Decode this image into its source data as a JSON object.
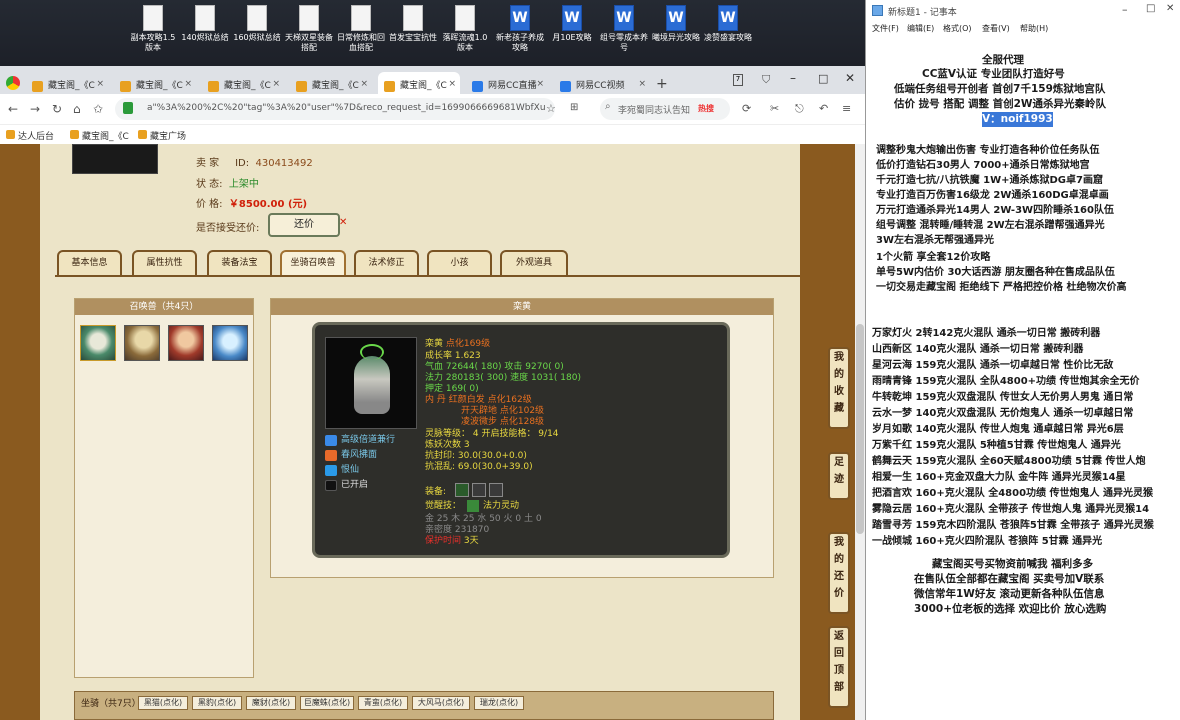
{
  "desktop": {
    "icons": [
      "副本攻略1.5版本",
      "140烬狱总结",
      "160烬狱总结",
      "天梯双星装备搭配",
      "日常修炼和回血搭配",
      "首发宝宝抗性",
      "落晖流魂1.0版本",
      "新老孩子养成攻略",
      "月10E攻略",
      "组号零成本养号",
      "曦境异光攻略",
      "凌赞盛宴攻略"
    ]
  },
  "browser": {
    "tabs": [
      "藏宝阁_《C",
      "藏宝阁_《C",
      "藏宝阁_《C",
      "藏宝阁_《C",
      "藏宝阁_《C",
      "网易CC直播",
      "网易CC视频"
    ],
    "url": "a\"%3A%200%2C%20\"tag\"%3A%20\"user\"%7D&reco_request_id=1699066669681WbfXu",
    "search": "李宛蜀同志认告知",
    "hot": "热搜",
    "bookmarks": [
      "达人后台",
      "藏宝阁_《C",
      "藏宝广场"
    ]
  },
  "listing": {
    "seller_label": "卖  家",
    "id_label": "ID:",
    "id_value": "430413492",
    "status_label": "状        态:",
    "status_value": "上架中",
    "price_label": "价        格:",
    "price_value": "￥8500.00 (元)",
    "offer_label": "是否接受还价:",
    "offer_button": "还价"
  },
  "tabs": [
    "基本信息",
    "属性抗性",
    "装备法宝",
    "坐骑召唤兽",
    "法术修正",
    "小孩",
    "外观道具"
  ],
  "pets_panel": {
    "title": "召唤兽（共4只）"
  },
  "detail_panel": {
    "title": "栾黄"
  },
  "card": {
    "name": "栾黄",
    "name_tag": "点化169级",
    "growth": "成长率 1.623",
    "hp": "气血 72644( 180) 攻击 9270( 0)",
    "mp": "法力 280183( 300) 速度 1031( 180)",
    "fate": "押定 169( 0)",
    "neidan1": "内    丹 红颜白发 点化162级",
    "neidan2": "开天辟地 点化102级",
    "neidan3": "凌波微步 点化128级",
    "skills": [
      "高级倍道兼行",
      "春风拂面",
      "恨仙",
      "已开启"
    ],
    "spirit": "灵脉等级： 4 开启技能格： 9/14",
    "refine": "炼妖次数 3",
    "resist1": "抗封印: 30.0(30.0+0.0)",
    "resist2": "抗混乱: 69.0(30.0+39.0)",
    "equip_label": "装备:",
    "awaken_label": "觉醒技：",
    "awaken_value": "法力灵动",
    "elements": "金 25  木 25  水 50  火 0  土 0",
    "intimacy": "亲密度 231870",
    "protect": "保护时间",
    "protect_value": "3天"
  },
  "side_buttons": [
    "我的收藏",
    "足迹",
    "我的还价",
    "返回顶部"
  ],
  "bottom": {
    "label": "坐骑（共7只）",
    "tabs": [
      "黑猫(点化)",
      "黑豹(点化)",
      "魔豺(点化)",
      "巨魔蛛(点化)",
      "青蛮(点化)",
      "大风马(点化)",
      "瑞龙(点化)"
    ]
  },
  "notepad": {
    "title": "新标题1 - 记事本",
    "menu": [
      "文件(F)",
      "编辑(E)",
      "格式(O)",
      "查看(V)",
      "帮助(H)"
    ],
    "lines": [
      "全服代理",
      "CC蓝V认证  专业团队打造好号",
      "低端任务组号开创者        首创7千159炼狱地宫队",
      "估价 拢号 搭配 调整        首创2W通杀异光秦岭队",
      "V：noif1993",
      "调整秒鬼大炮输出伤害          专业打造各种价位任务队伍",
      "低价打造钻石30男人               7000+通杀日常炼狱地宫",
      "千元打造七抗/八抗铁魔          1W+通杀炼狱DG卓7画窟",
      "专业打造百万伤害16级龙         2W通杀160DG卓混卓画",
      "万元打造通杀异光14男人        2W-3W四阶睡杀160队伍",
      "组号调整 混转睡/睡转混        2W左右混杀蹭帮强通异光",
      "                                                3W左右混杀无帮强通异光",
      "1个火箭 享全套12价攻略",
      "单号5W内估价 30大话西游       朋友圈各种在售成品队伍",
      "一切交易走藏宝阁 拒绝线下    严格把控价格 杜绝物次价高",
      "万家灯火 2转142克火混队 通杀一切日常 搬砖利器",
      "山西新区 140克火混队 通杀一切日常 搬砖利器",
      "星河云海 159克火混队 通杀一切卓越日常 性价比无敌",
      "雨晴青锋 159克火混队 全队4800+功绩 传世炮其余全无价",
      "牛转乾坤 159克火双盘混队 传世女人无价男人男鬼 通日常",
      "云水一梦 140克火双盘混队 无价炮鬼人 通杀一切卓越日常",
      "岁月如歌 140克火混队 传世人炮鬼 通卓越日常 异光6层",
      "万紫千红 159克火混队 5种植5甘霖 传世炮鬼人 通异光",
      "鹤舞云天 159克火混队 全60天赋4800功绩 5甘霖 传世人炮",
      "相爱一生 160+克金双盘大力队 金牛阵 通异光灵猴14星",
      "把酒言欢 160+克火混队 全4800功绩 传世炮鬼人 通异光灵猴",
      "雾隐云居 160+克火混队 全带孩子 传世炮人鬼 通异光灵猴14",
      "踏雪寻芳 159克木四阶混队 苍狼阵5甘霖 全带孩子 通异光灵猴",
      "一战倾城 160+克火四阶混队 苍狼阵 5甘霖 通异光",
      "藏宝阁买号买物资前喊我 福利多多",
      "在售队伍全部都在藏宝阁 买卖号加V联系",
      "微信常年1W好友 滚动更新各种队伍信息",
      "3000+位老板的选择 欢迎比价 放心选购"
    ]
  }
}
